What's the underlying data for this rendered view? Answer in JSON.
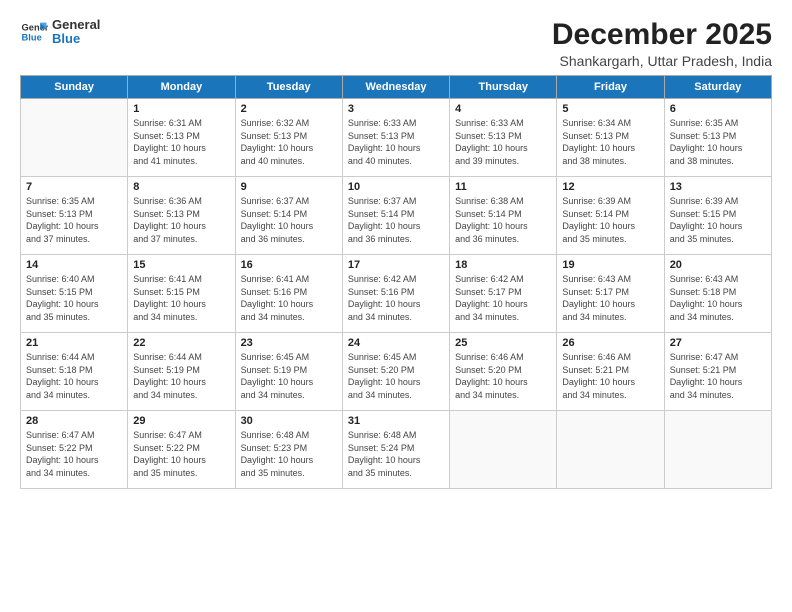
{
  "header": {
    "logo_line1": "General",
    "logo_line2": "Blue",
    "month": "December 2025",
    "location": "Shankargarh, Uttar Pradesh, India"
  },
  "weekdays": [
    "Sunday",
    "Monday",
    "Tuesday",
    "Wednesday",
    "Thursday",
    "Friday",
    "Saturday"
  ],
  "weeks": [
    [
      {
        "day": "",
        "info": ""
      },
      {
        "day": "1",
        "info": "Sunrise: 6:31 AM\nSunset: 5:13 PM\nDaylight: 10 hours\nand 41 minutes."
      },
      {
        "day": "2",
        "info": "Sunrise: 6:32 AM\nSunset: 5:13 PM\nDaylight: 10 hours\nand 40 minutes."
      },
      {
        "day": "3",
        "info": "Sunrise: 6:33 AM\nSunset: 5:13 PM\nDaylight: 10 hours\nand 40 minutes."
      },
      {
        "day": "4",
        "info": "Sunrise: 6:33 AM\nSunset: 5:13 PM\nDaylight: 10 hours\nand 39 minutes."
      },
      {
        "day": "5",
        "info": "Sunrise: 6:34 AM\nSunset: 5:13 PM\nDaylight: 10 hours\nand 38 minutes."
      },
      {
        "day": "6",
        "info": "Sunrise: 6:35 AM\nSunset: 5:13 PM\nDaylight: 10 hours\nand 38 minutes."
      }
    ],
    [
      {
        "day": "7",
        "info": "Sunrise: 6:35 AM\nSunset: 5:13 PM\nDaylight: 10 hours\nand 37 minutes."
      },
      {
        "day": "8",
        "info": "Sunrise: 6:36 AM\nSunset: 5:13 PM\nDaylight: 10 hours\nand 37 minutes."
      },
      {
        "day": "9",
        "info": "Sunrise: 6:37 AM\nSunset: 5:14 PM\nDaylight: 10 hours\nand 36 minutes."
      },
      {
        "day": "10",
        "info": "Sunrise: 6:37 AM\nSunset: 5:14 PM\nDaylight: 10 hours\nand 36 minutes."
      },
      {
        "day": "11",
        "info": "Sunrise: 6:38 AM\nSunset: 5:14 PM\nDaylight: 10 hours\nand 36 minutes."
      },
      {
        "day": "12",
        "info": "Sunrise: 6:39 AM\nSunset: 5:14 PM\nDaylight: 10 hours\nand 35 minutes."
      },
      {
        "day": "13",
        "info": "Sunrise: 6:39 AM\nSunset: 5:15 PM\nDaylight: 10 hours\nand 35 minutes."
      }
    ],
    [
      {
        "day": "14",
        "info": "Sunrise: 6:40 AM\nSunset: 5:15 PM\nDaylight: 10 hours\nand 35 minutes."
      },
      {
        "day": "15",
        "info": "Sunrise: 6:41 AM\nSunset: 5:15 PM\nDaylight: 10 hours\nand 34 minutes."
      },
      {
        "day": "16",
        "info": "Sunrise: 6:41 AM\nSunset: 5:16 PM\nDaylight: 10 hours\nand 34 minutes."
      },
      {
        "day": "17",
        "info": "Sunrise: 6:42 AM\nSunset: 5:16 PM\nDaylight: 10 hours\nand 34 minutes."
      },
      {
        "day": "18",
        "info": "Sunrise: 6:42 AM\nSunset: 5:17 PM\nDaylight: 10 hours\nand 34 minutes."
      },
      {
        "day": "19",
        "info": "Sunrise: 6:43 AM\nSunset: 5:17 PM\nDaylight: 10 hours\nand 34 minutes."
      },
      {
        "day": "20",
        "info": "Sunrise: 6:43 AM\nSunset: 5:18 PM\nDaylight: 10 hours\nand 34 minutes."
      }
    ],
    [
      {
        "day": "21",
        "info": "Sunrise: 6:44 AM\nSunset: 5:18 PM\nDaylight: 10 hours\nand 34 minutes."
      },
      {
        "day": "22",
        "info": "Sunrise: 6:44 AM\nSunset: 5:19 PM\nDaylight: 10 hours\nand 34 minutes."
      },
      {
        "day": "23",
        "info": "Sunrise: 6:45 AM\nSunset: 5:19 PM\nDaylight: 10 hours\nand 34 minutes."
      },
      {
        "day": "24",
        "info": "Sunrise: 6:45 AM\nSunset: 5:20 PM\nDaylight: 10 hours\nand 34 minutes."
      },
      {
        "day": "25",
        "info": "Sunrise: 6:46 AM\nSunset: 5:20 PM\nDaylight: 10 hours\nand 34 minutes."
      },
      {
        "day": "26",
        "info": "Sunrise: 6:46 AM\nSunset: 5:21 PM\nDaylight: 10 hours\nand 34 minutes."
      },
      {
        "day": "27",
        "info": "Sunrise: 6:47 AM\nSunset: 5:21 PM\nDaylight: 10 hours\nand 34 minutes."
      }
    ],
    [
      {
        "day": "28",
        "info": "Sunrise: 6:47 AM\nSunset: 5:22 PM\nDaylight: 10 hours\nand 34 minutes."
      },
      {
        "day": "29",
        "info": "Sunrise: 6:47 AM\nSunset: 5:22 PM\nDaylight: 10 hours\nand 35 minutes."
      },
      {
        "day": "30",
        "info": "Sunrise: 6:48 AM\nSunset: 5:23 PM\nDaylight: 10 hours\nand 35 minutes."
      },
      {
        "day": "31",
        "info": "Sunrise: 6:48 AM\nSunset: 5:24 PM\nDaylight: 10 hours\nand 35 minutes."
      },
      {
        "day": "",
        "info": ""
      },
      {
        "day": "",
        "info": ""
      },
      {
        "day": "",
        "info": ""
      }
    ]
  ]
}
